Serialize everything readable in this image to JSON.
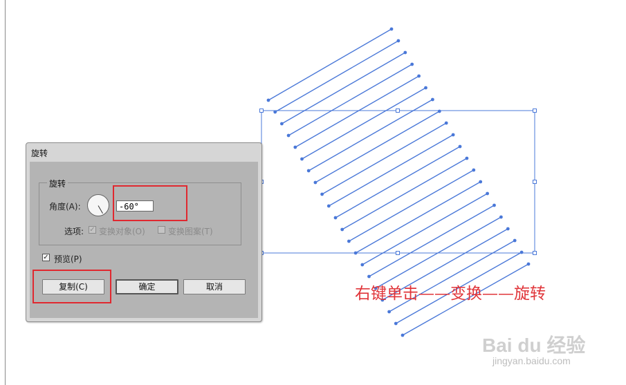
{
  "dialog": {
    "title": "旋转",
    "group_label": "旋转",
    "angle_label": "角度(A):",
    "angle_value": "-60°",
    "options_label": "选项:",
    "transform_objects": {
      "label": "变换对象(O)",
      "checked": true,
      "enabled": false
    },
    "transform_patterns": {
      "label": "变换图案(T)",
      "checked": false,
      "enabled": false
    },
    "preview": {
      "label": "预览(P)",
      "checked": true
    },
    "buttons": {
      "copy": "复制(C)",
      "ok": "确定",
      "cancel": "取消"
    }
  },
  "caption": "右键单击——变换——旋转",
  "watermark": {
    "logo": "Bai du 经验",
    "url": "jingyan.baidu.com"
  },
  "colors": {
    "line": "#4a78d8",
    "highlight": "#e0282f",
    "caption": "#e0353a"
  }
}
